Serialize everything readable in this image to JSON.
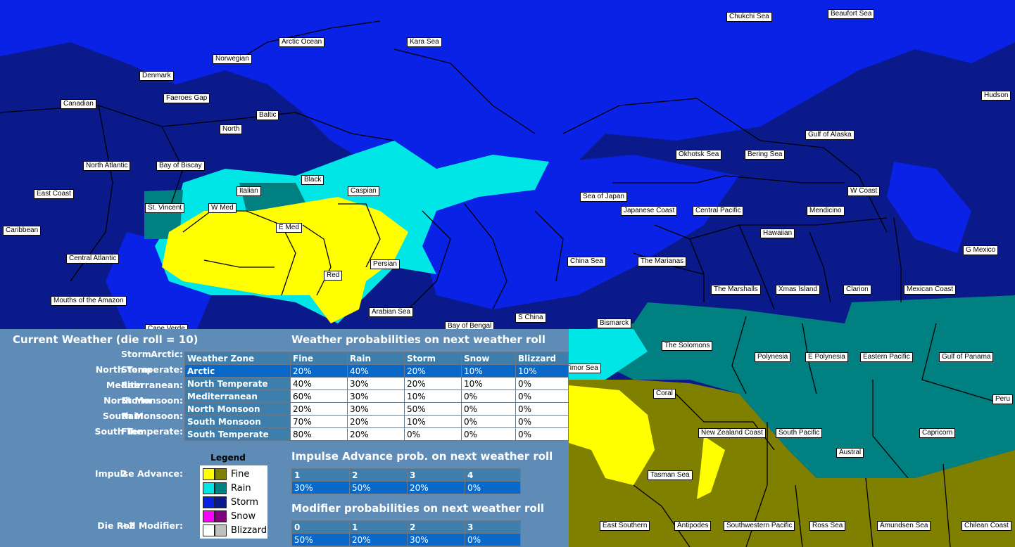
{
  "colors": {
    "storm": "#0a22e6",
    "storm_dark": "#0a1a8a",
    "rain": "#00e6e6",
    "rain_dark": "#008080",
    "fine": "#ffff00",
    "fine_dark": "#808000",
    "snow": "#ff00ff",
    "snow_dark": "#800080",
    "blizzard": "#ffffff",
    "blizzard_dark": "#c0c0c0",
    "panel": "#5e8cb6",
    "header": "#3d7eac",
    "selected": "#0a68c8"
  },
  "map_labels": [
    "Chukchi Sea",
    "Beaufort Sea",
    "Arctic Ocean",
    "Kara Sea",
    "Norwegian",
    "Denmark",
    "Canadian",
    "Faeroes Gap",
    "Hudson",
    "Baltic",
    "North",
    "Gulf of Alaska",
    "Okhotsk Sea",
    "Bering Sea",
    "North Atlantic",
    "Bay of Biscay",
    "Black",
    "Caspian",
    "Italian",
    "W Coast",
    "East Coast",
    "St. Vincent",
    "W Med",
    "Sea of Japan",
    "Japanese Coast",
    "Central Pacific",
    "Mendicino",
    "E Med",
    "Hawaiian",
    "Caribbean",
    "G Mexico",
    "Central Atlantic",
    "Persian",
    "China Sea",
    "The Marianas",
    "Red",
    "The Marshalls",
    "Xmas Island",
    "Clarion",
    "Mexican Coast",
    "Mouths of the Amazon",
    "Arabian Sea",
    "S China",
    "Cape Verde",
    "Bay of Bengal",
    "Bismarck",
    "The Solomons",
    "Polynesia",
    "E Polynesia",
    "Eastern Pacific",
    "Gulf of Panama",
    "Timor Sea",
    "Coral",
    "Peru",
    "New Zealand Coast",
    "South Pacific",
    "Capricorn",
    "Austral",
    "Tasman Sea",
    "East Southern",
    "Antipodes",
    "Southwestern Pacific",
    "Ross Sea",
    "Amundsen Sea",
    "Chilean Coast"
  ],
  "current_weather": {
    "title": "Current Weather (die roll = 10)",
    "zones": [
      {
        "name": "Arctic:",
        "value": "Storm"
      },
      {
        "name": "North Temperate:",
        "value": "Storm"
      },
      {
        "name": "Mediterranean:",
        "value": "Rain"
      },
      {
        "name": "North Monsoon:",
        "value": "Storm"
      },
      {
        "name": "South Monsoon:",
        "value": "Rain"
      },
      {
        "name": "South Temperate:",
        "value": "Fine"
      }
    ],
    "impulse_label": "Impulse Advance:",
    "impulse_value": "2",
    "modifier_label": "Die Roll Modifier:",
    "modifier_value": "+2"
  },
  "weather_prob": {
    "title": "Weather probabilities on next weather roll",
    "headers": [
      "Weather Zone",
      "Fine",
      "Rain",
      "Storm",
      "Snow",
      "Blizzard"
    ],
    "rows": [
      [
        "Arctic",
        "20%",
        "40%",
        "20%",
        "10%",
        "10%"
      ],
      [
        "North Temperate",
        "40%",
        "30%",
        "20%",
        "10%",
        "0%"
      ],
      [
        "Mediterranean",
        "60%",
        "30%",
        "10%",
        "0%",
        "0%"
      ],
      [
        "North Monsoon",
        "20%",
        "30%",
        "50%",
        "0%",
        "0%"
      ],
      [
        "South Monsoon",
        "70%",
        "20%",
        "10%",
        "0%",
        "0%"
      ],
      [
        "South Temperate",
        "80%",
        "20%",
        "0%",
        "0%",
        "0%"
      ]
    ]
  },
  "impulse_prob": {
    "title": "Impulse Advance prob. on next weather roll",
    "headers": [
      "1",
      "2",
      "3",
      "4"
    ],
    "values": [
      "30%",
      "50%",
      "20%",
      "0%"
    ]
  },
  "modifier_prob": {
    "title": "Modifier probabilities on next weather roll",
    "headers": [
      "0",
      "1",
      "2",
      "3"
    ],
    "values": [
      "50%",
      "20%",
      "30%",
      "0%"
    ]
  },
  "legend": {
    "title": "Legend",
    "items": [
      "Fine",
      "Rain",
      "Storm",
      "Snow",
      "Blizzard"
    ]
  }
}
